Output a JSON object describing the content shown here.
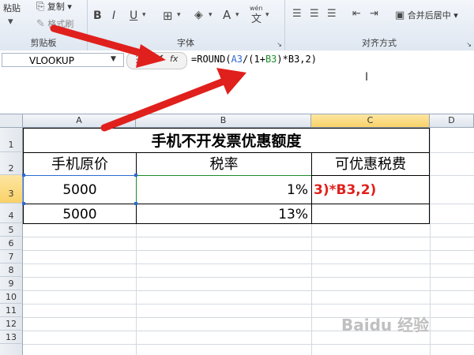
{
  "ribbon": {
    "paste_label": "粘贴",
    "copy_label": "复制",
    "format_painter_label": "格式刷",
    "clipboard_group": "剪贴板",
    "font_group": "字体",
    "align_group": "对齐方式",
    "merge_center_label": "合并后居中",
    "bold_label": "B",
    "italic_label": "I",
    "underline_label": "U",
    "font_color_label": "A",
    "wen_label": "wén"
  },
  "formula_bar": {
    "name_box": "VLOOKUP",
    "formula_prefix": "=ROUND(",
    "formula_ref1": "A3",
    "formula_mid": "/(1+",
    "formula_ref2": "B3",
    "formula_suffix": ")*B3,2)"
  },
  "columns": [
    "A",
    "B",
    "C",
    "D"
  ],
  "rows": [
    "1",
    "2",
    "3",
    "4",
    "5",
    "6",
    "7",
    "8",
    "9",
    "10",
    "11",
    "12",
    "13"
  ],
  "sheet": {
    "title": "手机不开发票优惠额度",
    "headers": [
      "手机原价",
      "税率",
      "可优惠税费"
    ],
    "rows": [
      {
        "price": "5000",
        "rate": "1%",
        "edit": "3)*B3,2)"
      },
      {
        "price": "5000",
        "rate": "13%",
        "edit": ""
      }
    ]
  },
  "watermark": "Baidu 经验",
  "colors": {
    "arrow": "#e0201c",
    "edit_text": "#e0201c",
    "ref_blue": "#2d6bcf",
    "ref_green": "#1b8b2a"
  }
}
